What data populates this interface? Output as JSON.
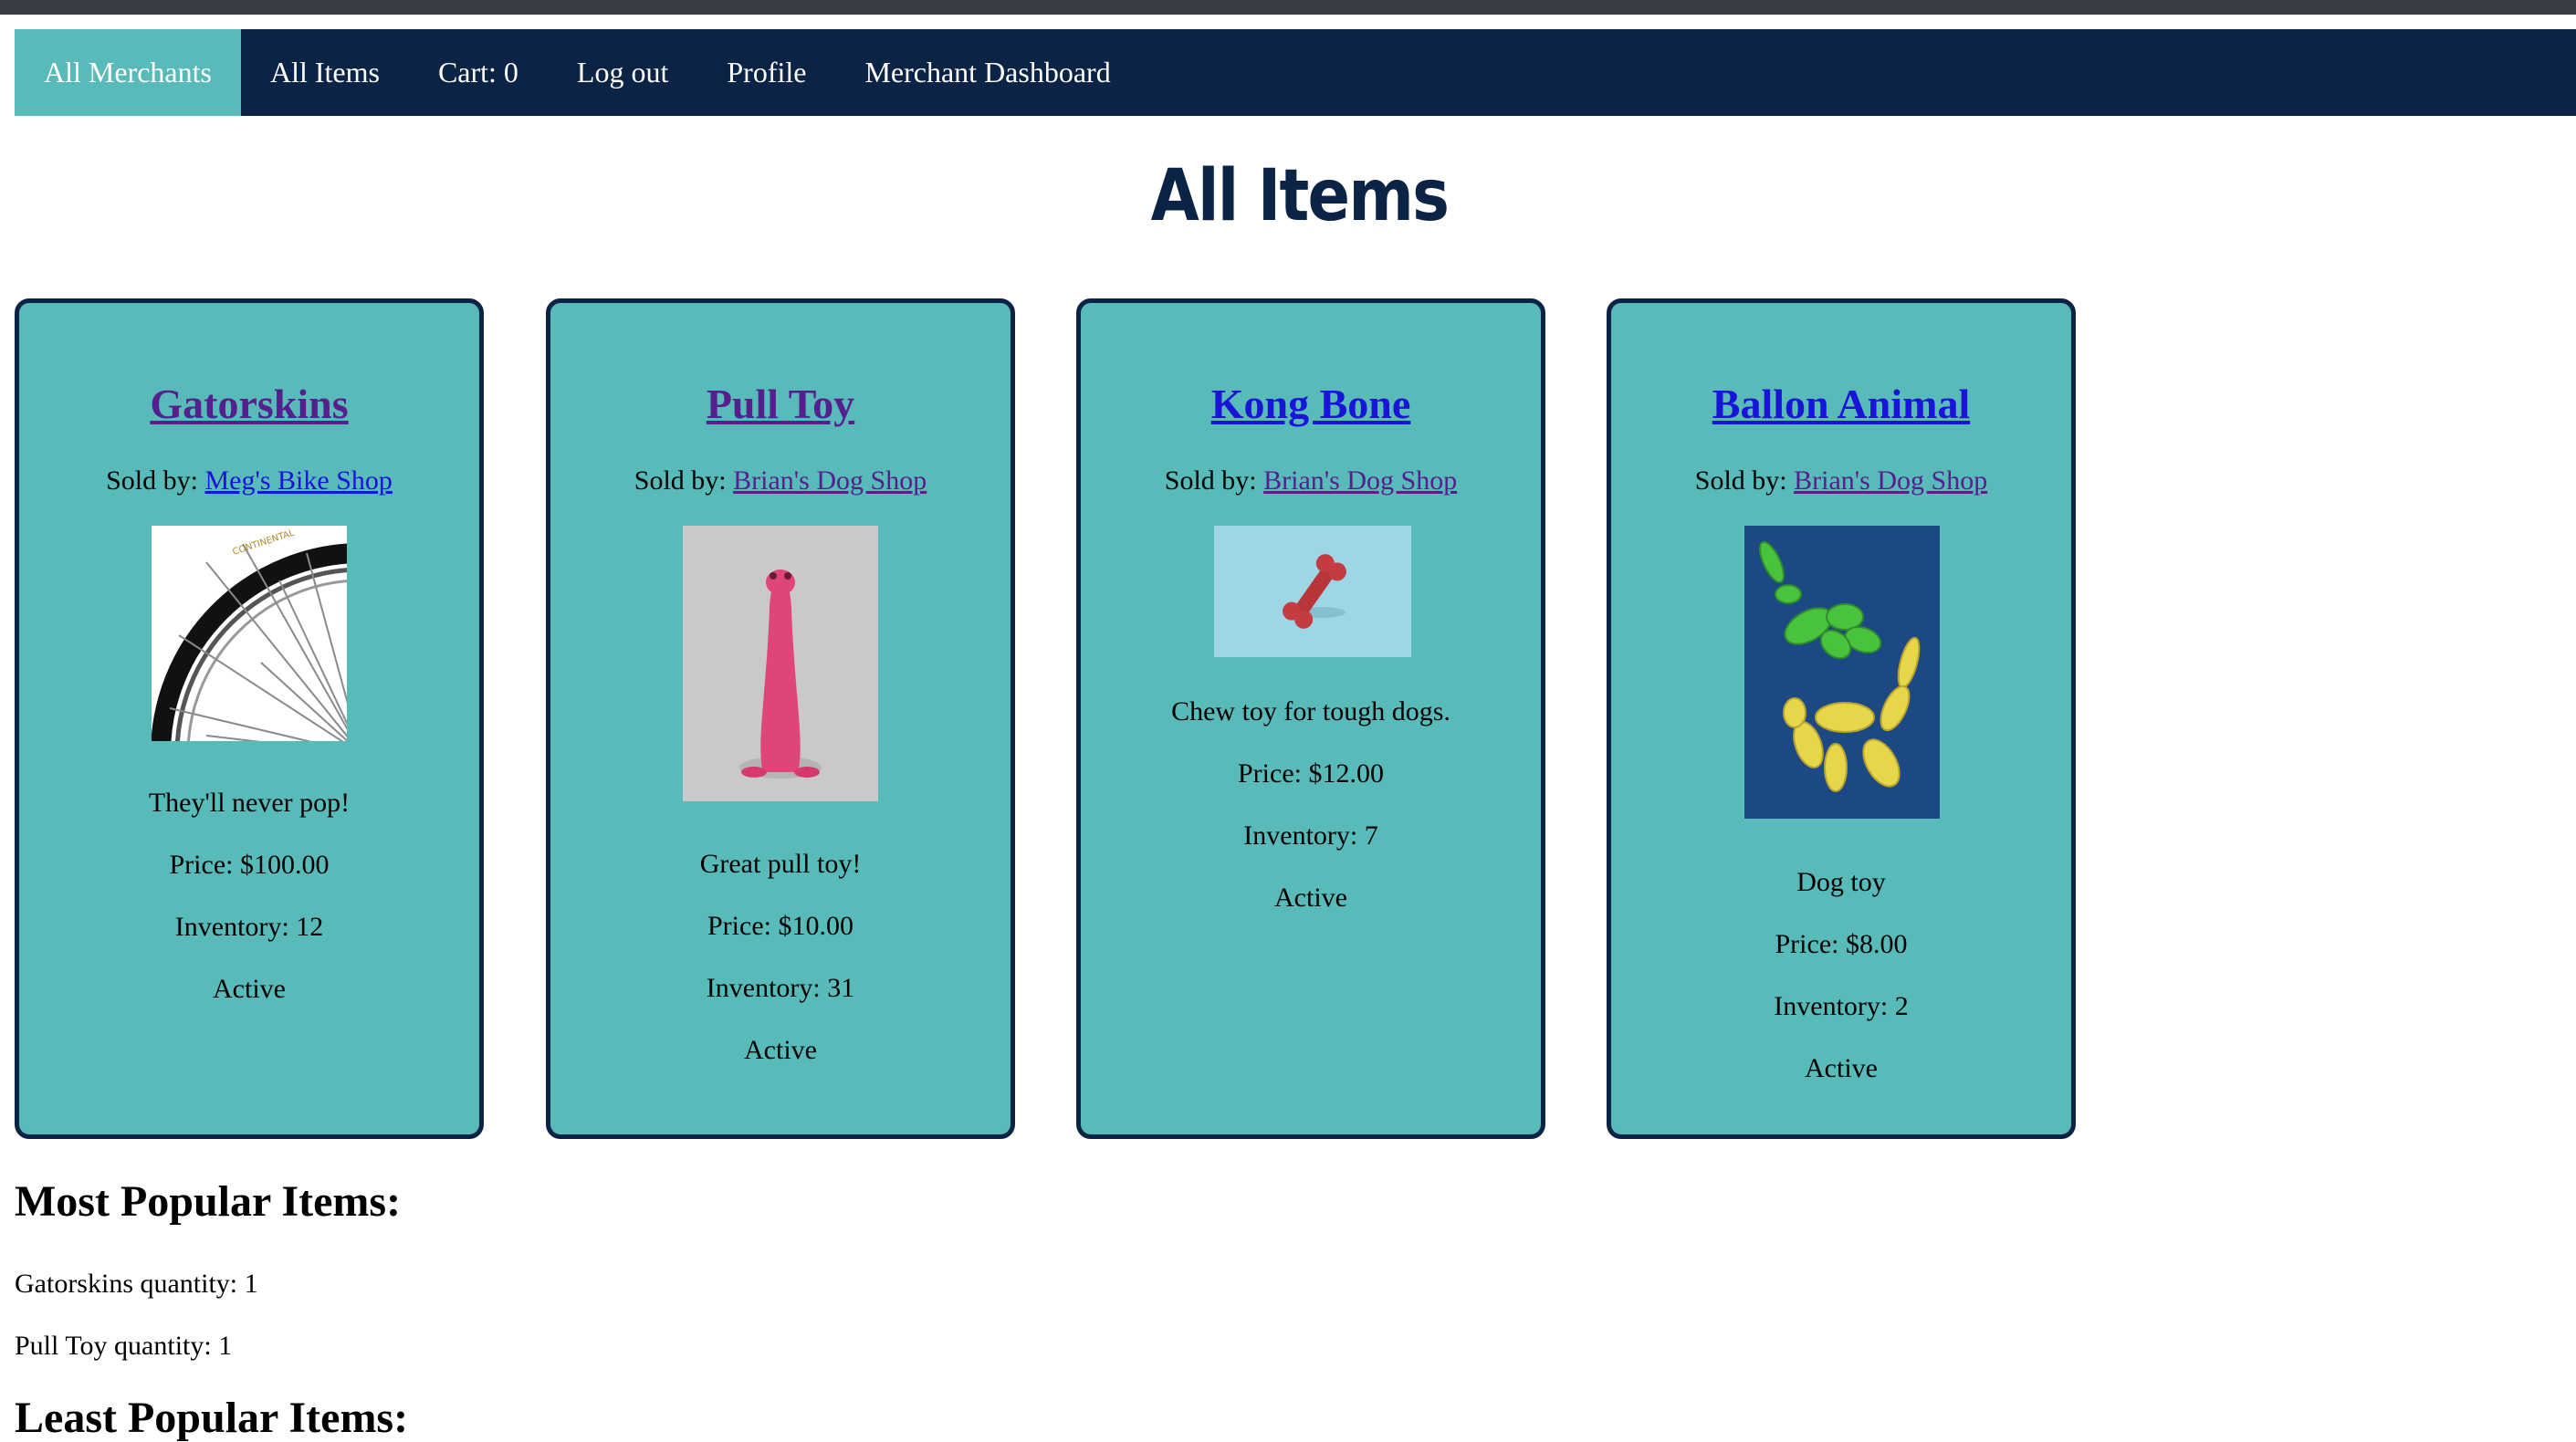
{
  "nav": {
    "items": [
      {
        "label": "All Merchants"
      },
      {
        "label": "All Items"
      },
      {
        "label": "Cart: 0"
      },
      {
        "label": "Log out"
      },
      {
        "label": "Profile"
      },
      {
        "label": "Merchant Dashboard"
      }
    ],
    "active_index": 0
  },
  "page_title": "All Items",
  "items": [
    {
      "name": "Gatorskins",
      "sold_by_label": "Sold by:",
      "merchant": "Meg's Bike Shop",
      "image": "bike-tire-image",
      "description": "They'll never pop!",
      "price": "Price: $100.00",
      "inventory": "Inventory: 12",
      "status": "Active"
    },
    {
      "name": "Pull Toy",
      "sold_by_label": "Sold by:",
      "merchant": "Brian's Dog Shop",
      "image": "pink-pull-toy-image",
      "description": "Great pull toy!",
      "price": "Price: $10.00",
      "inventory": "Inventory: 31",
      "status": "Active"
    },
    {
      "name": "Kong Bone",
      "sold_by_label": "Sold by:",
      "merchant": "Brian's Dog Shop",
      "image": "red-bone-image",
      "description": "Chew toy for tough dogs.",
      "price": "Price: $12.00",
      "inventory": "Inventory: 7",
      "status": "Active"
    },
    {
      "name": "Ballon Animal",
      "sold_by_label": "Sold by:",
      "merchant": "Brian's Dog Shop",
      "image": "balloon-animals-image",
      "description": "Dog toy",
      "price": "Price: $8.00",
      "inventory": "Inventory: 2",
      "status": "Active"
    }
  ],
  "most_popular": {
    "heading": "Most Popular Items:",
    "lines": [
      "Gatorskins quantity: 1",
      "Pull Toy quantity: 1"
    ]
  },
  "least_popular": {
    "heading": "Least Popular Items:"
  },
  "colors": {
    "navbar": "#0b2344",
    "accent_teal": "#59baba",
    "title": "#0b2344",
    "link": "#1a14d8",
    "visited_link": "#55208d"
  }
}
